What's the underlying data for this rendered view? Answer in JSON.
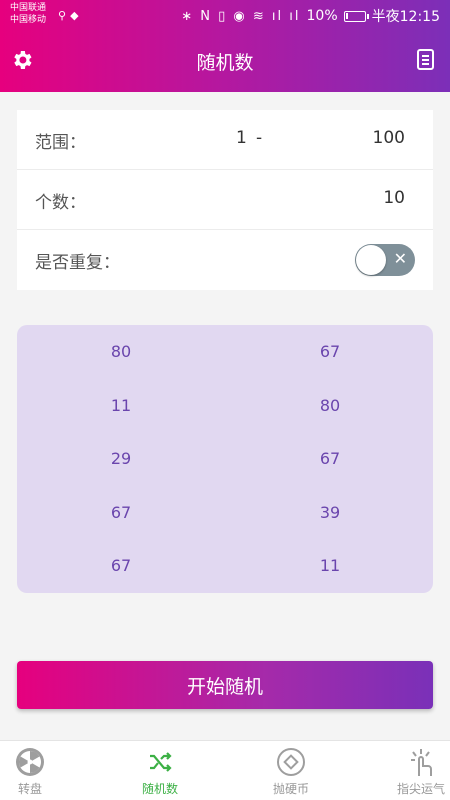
{
  "status_bar": {
    "carrier_1": "中国联通",
    "carrier_2": "中国移动",
    "battery": "10%",
    "time": "半夜12:15"
  },
  "app_bar": {
    "title": "随机数",
    "left_icon": "gear-icon",
    "right_icon": "document-icon"
  },
  "settings": {
    "range_label": "范围：",
    "range_min": "1",
    "range_sep": "-",
    "range_max": "100",
    "count_label": "个数：",
    "count_value": "10",
    "repeat_label": "是否重复：",
    "repeat_enabled": false,
    "toggle_off_glyph": "✕"
  },
  "results": [
    "80",
    "67",
    "11",
    "80",
    "29",
    "67",
    "67",
    "39",
    "67",
    "11"
  ],
  "start_button": {
    "label": "开始随机"
  },
  "bottom_nav": [
    {
      "label": "转盘",
      "icon": "wheel-icon",
      "active": false
    },
    {
      "label": "随机数",
      "icon": "shuffle-icon",
      "active": true
    },
    {
      "label": "抛硬币",
      "icon": "coin-icon",
      "active": false
    },
    {
      "label": "指尖运气",
      "icon": "finger-tap-icon",
      "active": false
    }
  ],
  "colors": {
    "gradient_start": "#e6007e",
    "gradient_end": "#7c2fb8",
    "results_bg": "#e1d8f1",
    "results_text": "#6a45ad",
    "active_nav": "#3cb045",
    "toggle_off": "#7f9099"
  }
}
